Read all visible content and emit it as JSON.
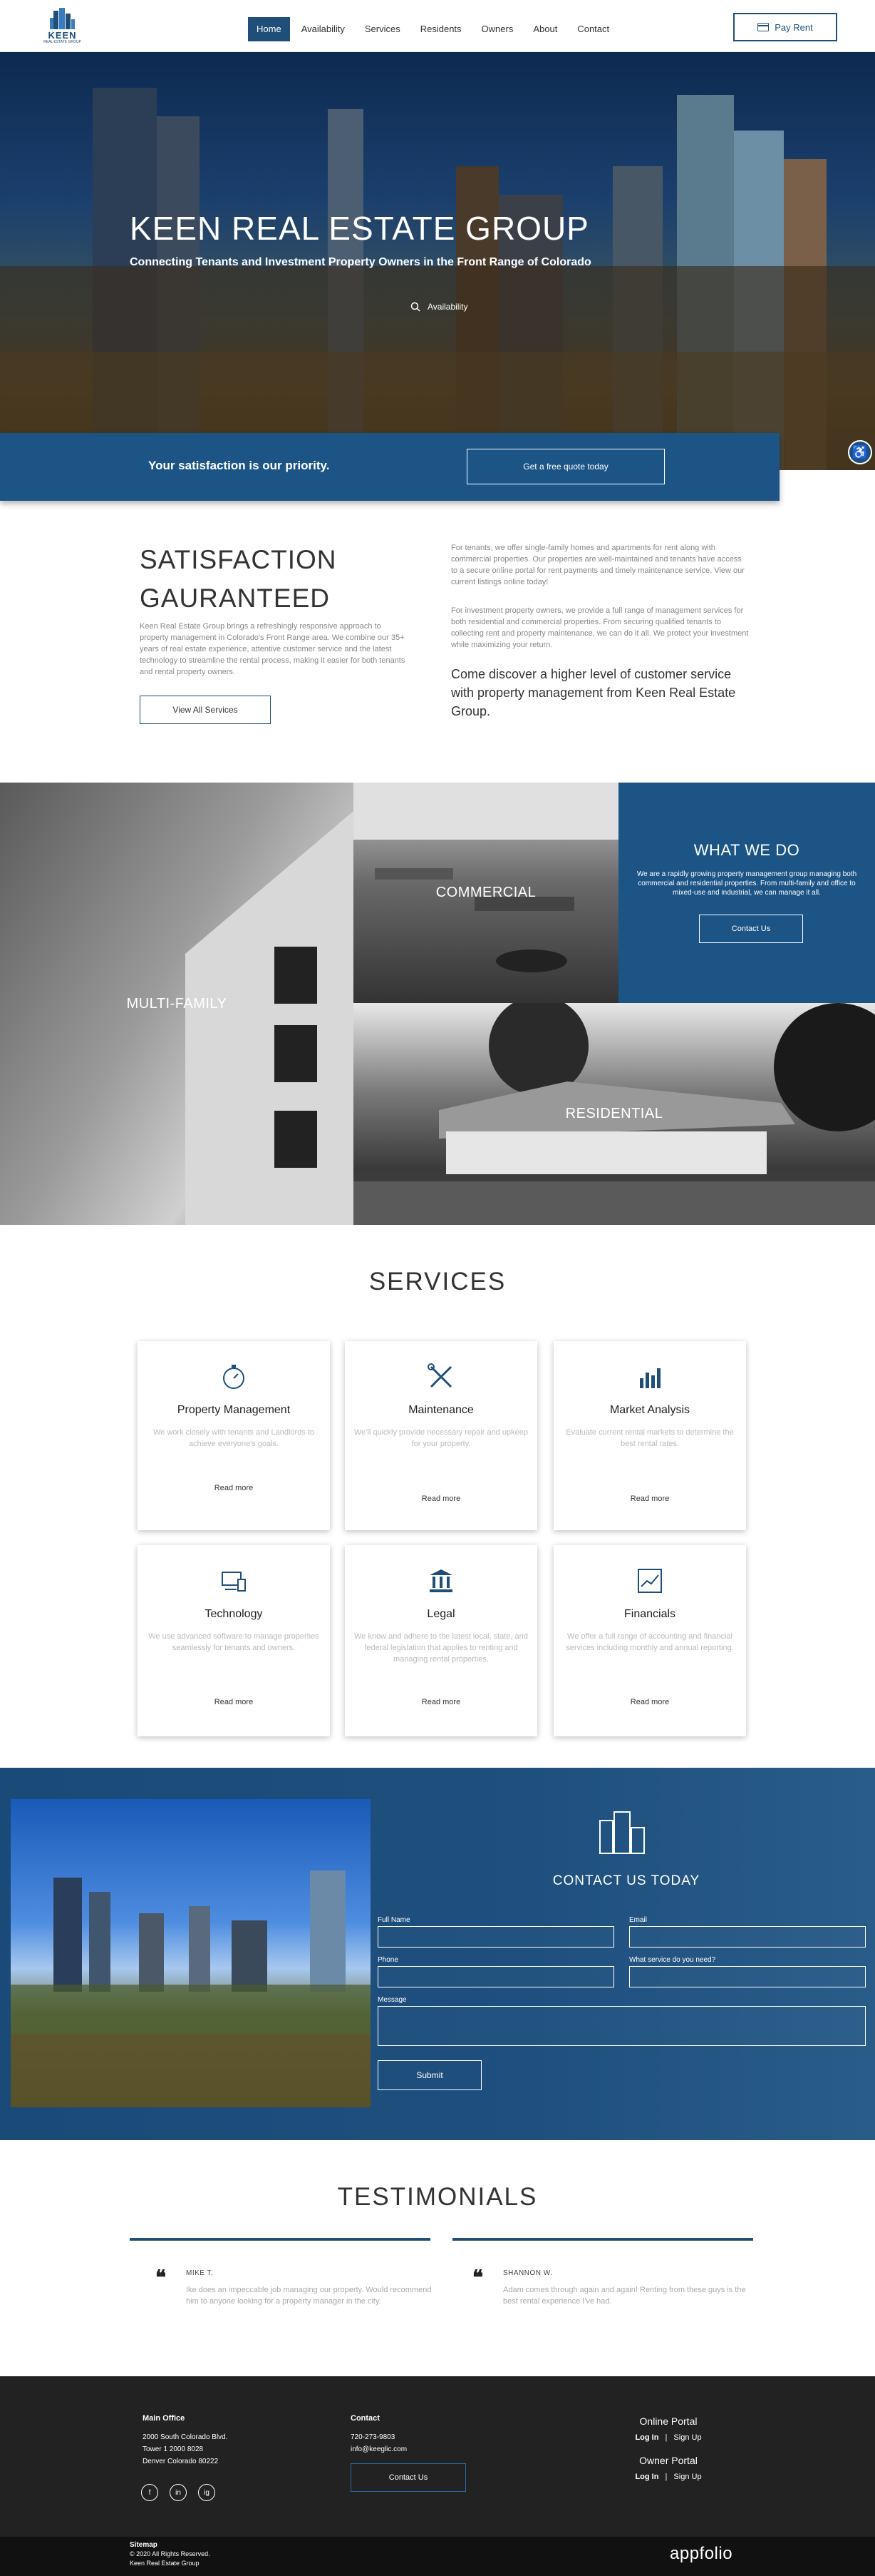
{
  "header": {
    "logo_text": "KEEN",
    "logo_tag": "REAL ESTATE GROUP",
    "nav": [
      "Home",
      "Availability",
      "Services",
      "Residents",
      "Owners",
      "About",
      "Contact"
    ],
    "pay_rent": "Pay Rent"
  },
  "hero": {
    "title": "KEEN REAL ESTATE GROUP",
    "subtitle": "Connecting Tenants and Investment Property Owners in the Front Range of Colorado",
    "availability": "Availability"
  },
  "priority": {
    "text": "Your satisfaction is our priority.",
    "button": "Get a free quote today"
  },
  "satisfaction": {
    "title_line1": "SATISFACTION",
    "title_line2": "GAURANTEED",
    "body": "Keen Real Estate Group brings a refreshingly responsive approach to property management in Colorado's Front Range area. We combine our 35+ years of real estate experience, attentive customer service and the latest technology to streamline the rental process, making it easier for both tenants and rental property owners.",
    "button": "View All Services",
    "p1": "For tenants, we offer single-family homes and apartments for rent along with commercial properties. Our properties are well-maintained and tenants have access to a secure online portal for rent payments and timely maintenance service. View our current listings online today!",
    "p2": "For investment property owners, we provide a full range of management services for both residential and commercial properties. From securing qualified tenants to collecting rent and property maintenance, we can do it all. We protect your investment while maximizing your return.",
    "discover": "Come discover a higher level of customer service with property management from Keen Real Estate Group."
  },
  "what_we_do": {
    "tiles": {
      "multifamily": "MULTI-FAMILY",
      "commercial": "COMMERCIAL",
      "residential": "RESIDENTIAL"
    },
    "title": "WHAT WE DO",
    "text": "We are a rapidly growing property management group managing both commercial and residential properties. From multi-family and office to mixed-use and industrial, we can manage it all.",
    "button": "Contact Us"
  },
  "services": {
    "title": "SERVICES",
    "cards": [
      {
        "icon": "stopwatch-icon",
        "title": "Property Management",
        "desc": "We work closely with tenants and Landlords to achieve everyone's goals.",
        "more": "Read more"
      },
      {
        "icon": "tools-icon",
        "title": "Maintenance",
        "desc": "We'll quickly provide necessary repair and upkeep for your property.",
        "more": "Read more"
      },
      {
        "icon": "bar-chart-icon",
        "title": "Market Analysis",
        "desc": "Evaluate current rental markets to determine the best rental rates.",
        "more": "Read more"
      },
      {
        "icon": "devices-icon",
        "title": "Technology",
        "desc": "We use advanced software to manage properties seamlessly for tenants and owners.",
        "more": "Read more"
      },
      {
        "icon": "courthouse-icon",
        "title": "Legal",
        "desc": "We know and adhere to the latest local, state, and federal legislation that applies to renting and managing rental properties.",
        "more": "Read more"
      },
      {
        "icon": "trend-chart-icon",
        "title": "Financials",
        "desc": "We offer a full range of accounting and financial services including monthly and annual reporting.",
        "more": "Read more"
      }
    ]
  },
  "contact": {
    "title": "CONTACT US TODAY",
    "full_name": "Full Name",
    "email": "Email",
    "phone": "Phone",
    "service": "What service do you need?",
    "message": "Message",
    "submit": "Submit"
  },
  "testimonials": {
    "title": "TESTIMONIALS",
    "items": [
      {
        "name": "MIKE T.",
        "text": "Ike does an impeccable job managing our property. Would recommend him to anyone looking for a property manager in the city."
      },
      {
        "name": "SHANNON W.",
        "text": "Adam comes through again and again! Renting from these guys is the best rental experience I've had."
      }
    ]
  },
  "footer": {
    "main_office": "Main Office",
    "addr1": "2000 South Colorado Blvd.",
    "addr2": "Tower 1 2000 8028",
    "addr3": "Denver Colorado 80222",
    "contact": "Contact",
    "phone": "720-273-9803",
    "email": "info@keeglic.com",
    "contact_btn": "Contact Us",
    "online_portal": "Online Portal",
    "owner_portal": "Owner Portal",
    "login": "Log In",
    "sep": "|",
    "signup": "Sign Up",
    "sitemap": "Sitemap",
    "copyright": "© 2020 All Rights Reserved.",
    "company": "Keen Real Estate Group",
    "appfolio": "appfolio",
    "social": [
      "f",
      "in",
      "ig"
    ]
  },
  "colors": {
    "brand": "#1f4e79",
    "accent": "#1c5486",
    "footer": "#222222"
  }
}
